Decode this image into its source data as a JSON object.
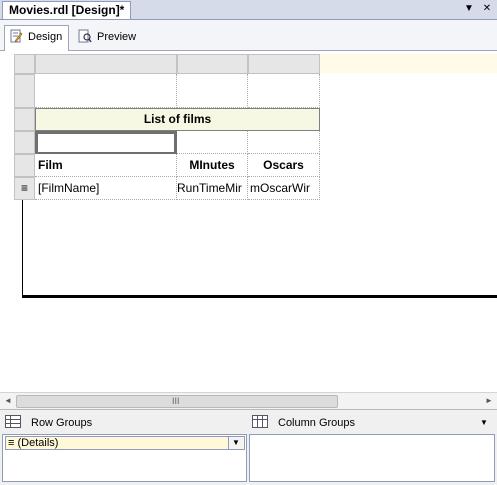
{
  "document_tab": {
    "title": "Movies.rdl [Design]*"
  },
  "window_controls": {
    "dropdown": "▼",
    "close": "✕"
  },
  "view_tabs": [
    {
      "label": "Design",
      "active": true
    },
    {
      "label": "Preview",
      "active": false
    }
  ],
  "tablix": {
    "title": "List of films",
    "headers": [
      "Film",
      "MInutes",
      "Oscars"
    ],
    "detail_row": [
      "[FilmName]",
      "RunTimeMir",
      "mOscarWir"
    ],
    "row_handle_icon": "≡"
  },
  "scrollbar": {
    "left_arrow": "◄",
    "right_arrow": "►",
    "grip": "III"
  },
  "grouping": {
    "row_groups_label": "Row Groups",
    "column_groups_label": "Column Groups",
    "details_item": "(Details)",
    "details_icon": "≡",
    "dropdown_arrow": "▼"
  },
  "colors": {
    "title_bg": "#f7f8e4",
    "canvas_bg": "#fffbe8",
    "details_bg": "#fff9d9"
  }
}
